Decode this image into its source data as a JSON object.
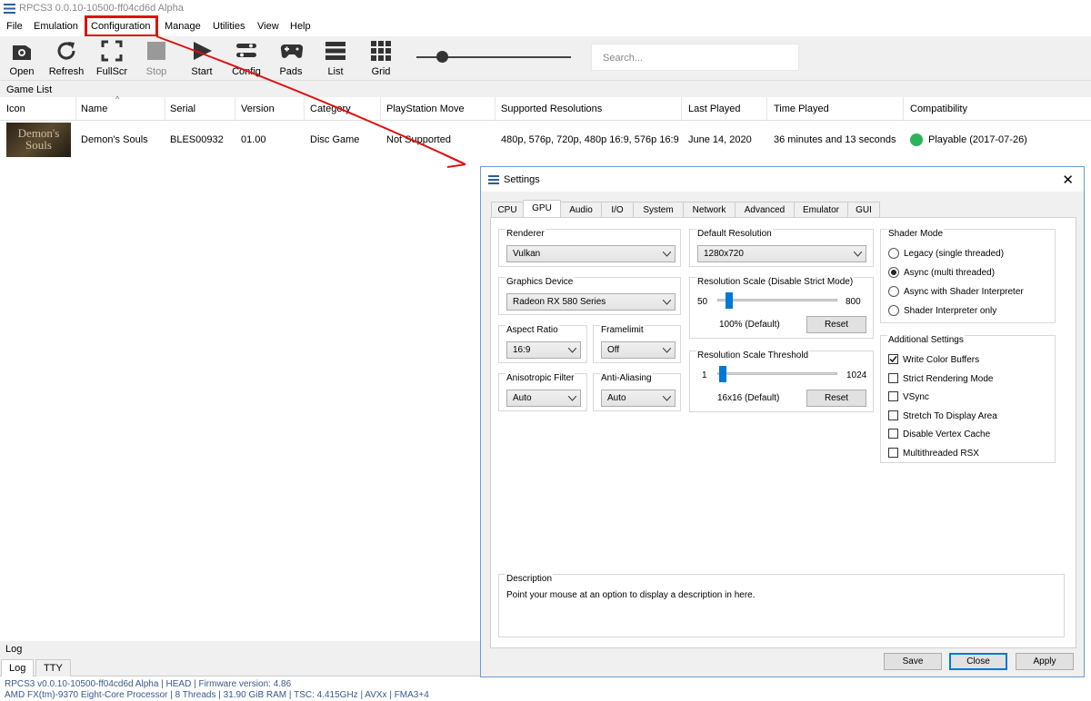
{
  "window": {
    "title": "RPCS3 0.0.10-10500-ff04cd6d Alpha"
  },
  "menu": [
    "File",
    "Emulation",
    "Configuration",
    "Manage",
    "Utilities",
    "View",
    "Help"
  ],
  "toolbar": {
    "open": "Open",
    "refresh": "Refresh",
    "fullscr": "FullScr",
    "stop": "Stop",
    "start": "Start",
    "config": "Config",
    "pads": "Pads",
    "list": "List",
    "grid": "Grid",
    "search_placeholder": "Search..."
  },
  "gamelist": {
    "label": "Game List",
    "columns": [
      "Icon",
      "Name",
      "Serial",
      "Version",
      "Category",
      "PlayStation Move",
      "Supported Resolutions",
      "Last Played",
      "Time Played",
      "Compatibility"
    ],
    "rows": [
      {
        "cover_text": "Demon's Souls",
        "name": "Demon's Souls",
        "serial": "BLES00932",
        "version": "01.00",
        "category": "Disc Game",
        "move": "Not Supported",
        "resolutions": "480p, 576p, 720p, 480p 16:9, 576p 16:9",
        "last_played": "June 14, 2020",
        "time_played": "36 minutes and 13 seconds",
        "compat": "Playable (2017-07-26)",
        "compat_color": "#2db35a"
      }
    ]
  },
  "log": {
    "label": "Log",
    "tabs": [
      "Log",
      "TTY"
    ],
    "status_line1": "RPCS3 v0.0.10-10500-ff04cd6d Alpha | HEAD | Firmware version: 4.86",
    "status_line2": "AMD FX(tm)-9370 Eight-Core Processor | 8 Threads | 31.90 GiB RAM | TSC: 4.415GHz | AVXx | FMA3+4"
  },
  "settings": {
    "title": "Settings",
    "tabs": [
      "CPU",
      "GPU",
      "Audio",
      "I/O",
      "System",
      "Network",
      "Advanced",
      "Emulator",
      "GUI"
    ],
    "active_tab": "GPU",
    "renderer": {
      "label": "Renderer",
      "value": "Vulkan"
    },
    "graphics_device": {
      "label": "Graphics Device",
      "value": "Radeon RX 580 Series"
    },
    "aspect_ratio": {
      "label": "Aspect Ratio",
      "value": "16:9"
    },
    "framelimit": {
      "label": "Framelimit",
      "value": "Off"
    },
    "anisotropic": {
      "label": "Anisotropic Filter",
      "value": "Auto"
    },
    "antialiasing": {
      "label": "Anti-Aliasing",
      "value": "Auto"
    },
    "default_resolution": {
      "label": "Default Resolution",
      "value": "1280x720"
    },
    "res_scale": {
      "label": "Resolution Scale (Disable Strict Mode)",
      "min": "50",
      "max": "800",
      "current": "100% (Default)",
      "reset": "Reset",
      "level": 0.071
    },
    "res_threshold": {
      "label": "Resolution Scale Threshold",
      "min": "1",
      "max": "1024",
      "current": "16x16 (Default)",
      "reset": "Reset",
      "level": 0.015
    },
    "shader_mode": {
      "label": "Shader Mode",
      "options": [
        "Legacy (single threaded)",
        "Async (multi threaded)",
        "Async with Shader Interpreter",
        "Shader Interpreter only"
      ],
      "selected": 1
    },
    "additional": {
      "label": "Additional Settings",
      "options": [
        {
          "label": "Write Color Buffers",
          "checked": true
        },
        {
          "label": "Strict Rendering Mode",
          "checked": false
        },
        {
          "label": "VSync",
          "checked": false
        },
        {
          "label": "Stretch To Display Area",
          "checked": false
        },
        {
          "label": "Disable Vertex Cache",
          "checked": false
        },
        {
          "label": "Multithreaded RSX",
          "checked": false
        }
      ]
    },
    "description": {
      "label": "Description",
      "text": "Point your mouse at an option to display a description in here."
    },
    "buttons": {
      "save": "Save",
      "close": "Close",
      "apply": "Apply"
    }
  },
  "accent_colors": {
    "annotation": "#d11",
    "selection": "#0078d7"
  }
}
